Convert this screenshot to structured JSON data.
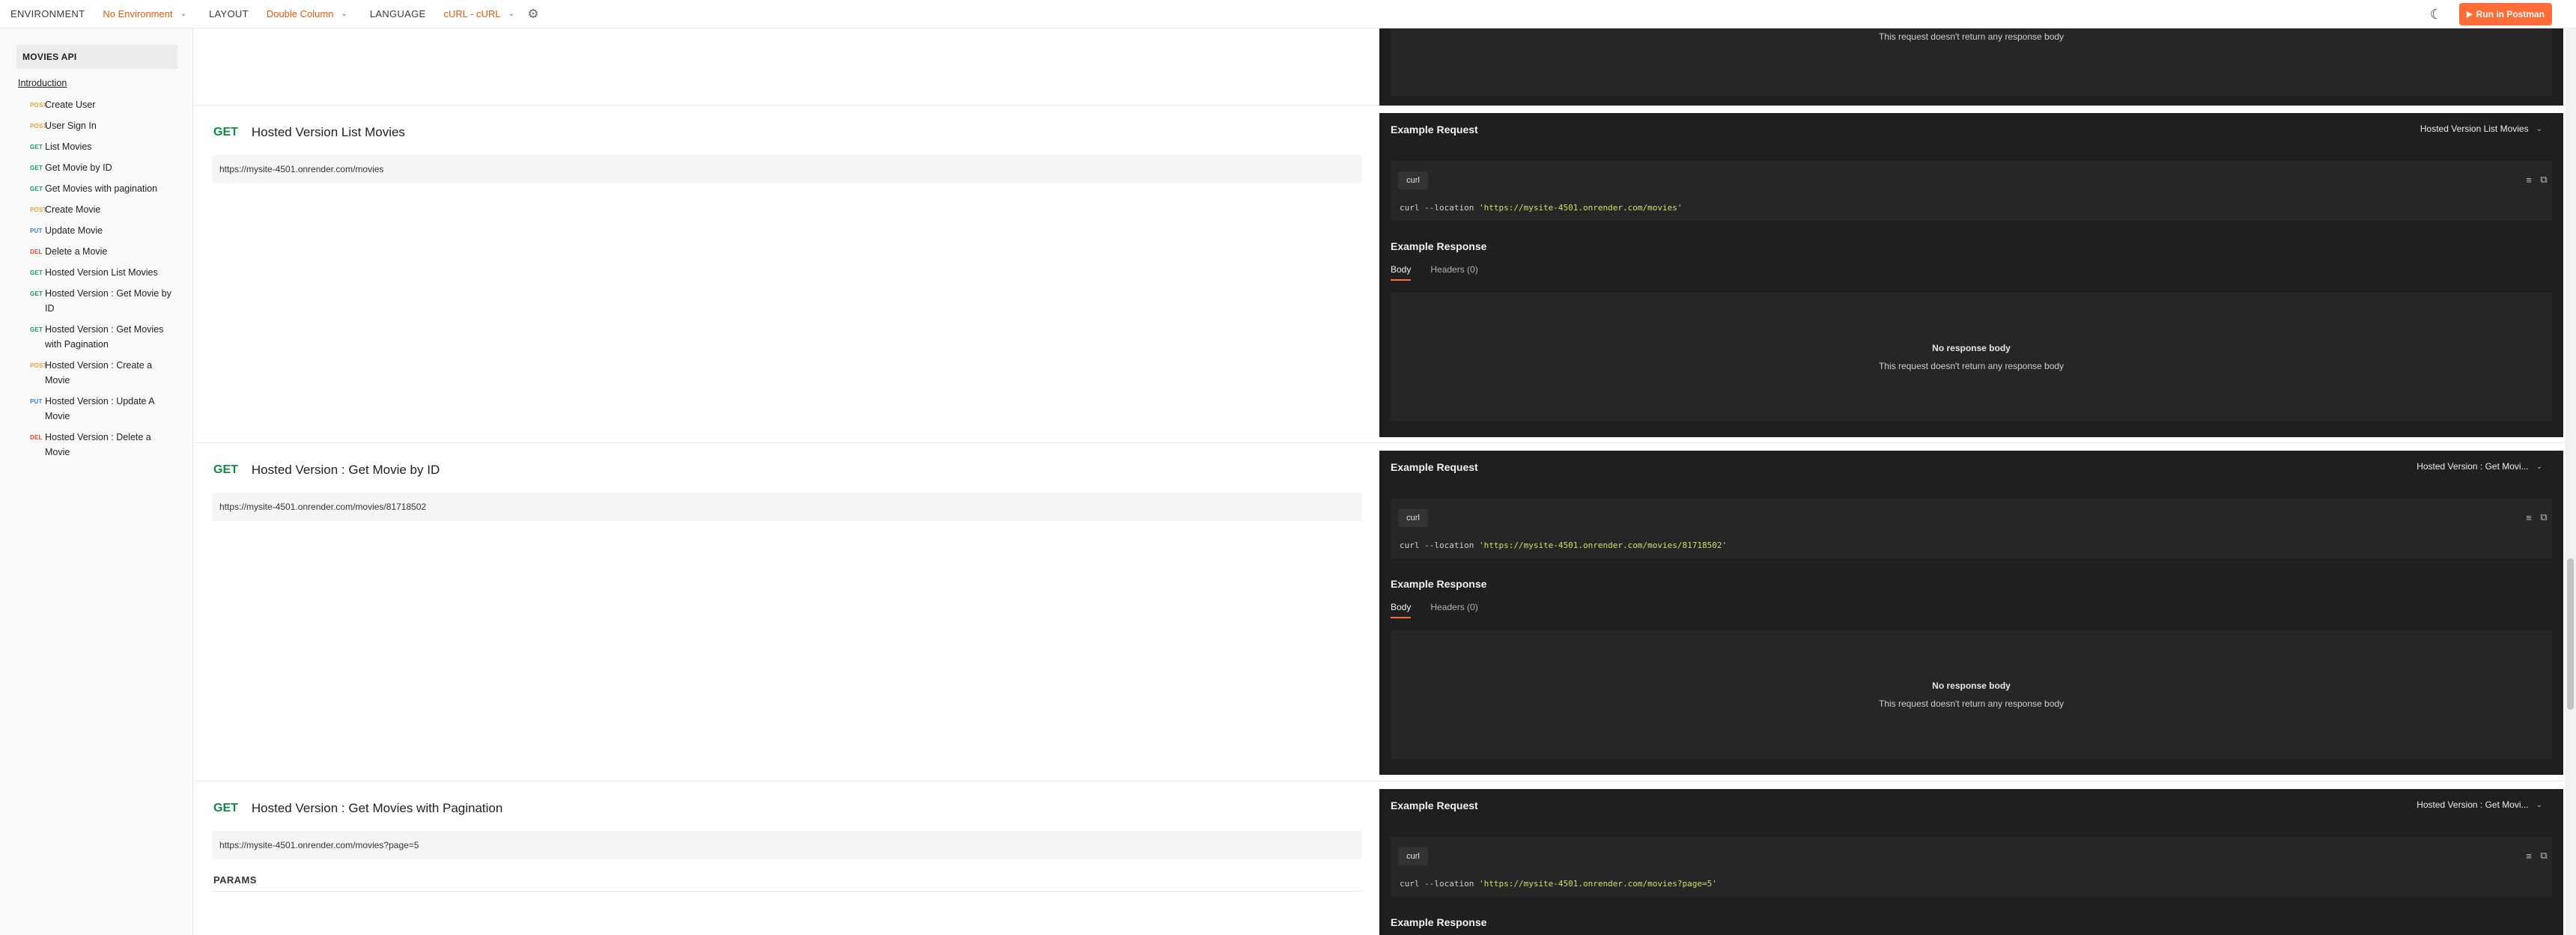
{
  "topbar": {
    "environment_label": "ENVIRONMENT",
    "environment_value": "No Environment",
    "layout_label": "LAYOUT",
    "layout_value": "Double Column",
    "language_label": "LANGUAGE",
    "language_value": "cURL - cURL",
    "run_button": "Run in Postman"
  },
  "sidebar": {
    "title": "MOVIES API",
    "intro": "Introduction",
    "items": [
      {
        "method": "POST",
        "label": "Create User"
      },
      {
        "method": "POST",
        "label": "User Sign In"
      },
      {
        "method": "GET",
        "label": "List Movies"
      },
      {
        "method": "GET",
        "label": "Get Movie by ID"
      },
      {
        "method": "GET",
        "label": "Get Movies with pagination"
      },
      {
        "method": "POST",
        "label": "Create Movie"
      },
      {
        "method": "PUT",
        "label": "Update Movie"
      },
      {
        "method": "DEL",
        "label": "Delete a Movie"
      },
      {
        "method": "GET",
        "label": "Hosted Version List Movies"
      },
      {
        "method": "GET",
        "label": "Hosted Version : Get Movie by ID"
      },
      {
        "method": "GET",
        "label": "Hosted Version : Get Movies with Pagination"
      },
      {
        "method": "POST",
        "label": "Hosted Version : Create a Movie"
      },
      {
        "method": "PUT",
        "label": "Hosted Version : Update A Movie"
      },
      {
        "method": "DEL",
        "label": "Hosted Version : Delete a Movie"
      }
    ]
  },
  "top_partial": {
    "sub": "This request doesn't return any response body"
  },
  "sections": [
    {
      "method": "GET",
      "name": "Hosted Version List Movies",
      "url": "https://mysite-4501.onrender.com/movies",
      "example_request": "Example Request",
      "example_select": "Hosted Version List Movies",
      "lang": "curl",
      "code_prefix": "curl --location ",
      "code_string": "'https://mysite-4501.onrender.com/movies'",
      "example_response": "Example Response",
      "tab_body": "Body",
      "tab_headers": "Headers (0)",
      "no_body": "No response body",
      "no_body_sub": "This request doesn't return any response body"
    },
    {
      "method": "GET",
      "name": "Hosted Version : Get Movie by ID",
      "url": "https://mysite-4501.onrender.com/movies/81718502",
      "example_request": "Example Request",
      "example_select": "Hosted Version : Get Movi...",
      "lang": "curl",
      "code_prefix": "curl --location ",
      "code_string": "'https://mysite-4501.onrender.com/movies/81718502'",
      "example_response": "Example Response",
      "tab_body": "Body",
      "tab_headers": "Headers (0)",
      "no_body": "No response body",
      "no_body_sub": "This request doesn't return any response body"
    },
    {
      "method": "GET",
      "name": "Hosted Version : Get Movies with Pagination",
      "url": "https://mysite-4501.onrender.com/movies?page=5",
      "params": "PARAMS",
      "example_request": "Example Request",
      "example_select": "Hosted Version : Get Movi...",
      "lang": "curl",
      "code_prefix": "curl --location ",
      "code_string": "'https://mysite-4501.onrender.com/movies?page=5'",
      "example_response": "Example Response"
    }
  ],
  "colors": {
    "accent": "#ff6c37",
    "get": "#17a05d",
    "post": "#e8a23b",
    "put": "#3a7dd8",
    "delete": "#e0453a",
    "panel": "#1f1f1f"
  }
}
